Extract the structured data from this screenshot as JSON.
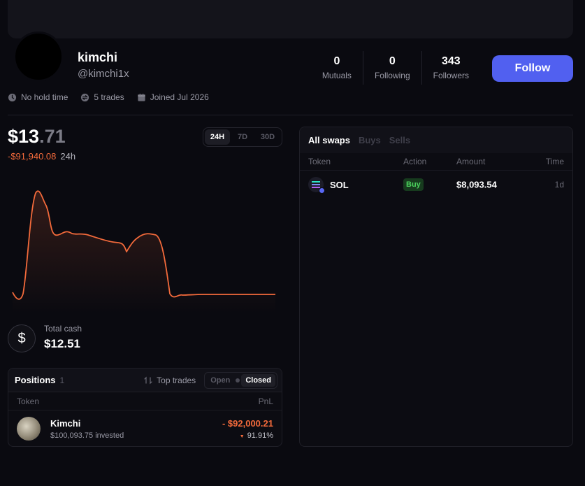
{
  "profile": {
    "name": "kimchi",
    "handle": "@kimchi1x",
    "follow_label": "Follow",
    "stats": [
      {
        "value": "0",
        "label": "Mutuals"
      },
      {
        "value": "0",
        "label": "Following"
      },
      {
        "value": "343",
        "label": "Followers"
      }
    ],
    "meta": {
      "hold_time": "No hold time",
      "trades": "5 trades",
      "joined": "Joined Jul 2026"
    }
  },
  "portfolio": {
    "price_int": "$13",
    "price_dec": ".71",
    "change": "-$91,940.08",
    "change_period": "24h",
    "ranges": [
      "24H",
      "7D",
      "30D"
    ],
    "active_range": "24H",
    "line_color": "#f36a3b",
    "cash_label": "Total cash",
    "cash_icon": "dollar-icon",
    "cash_value": "$12.51"
  },
  "positions": {
    "title": "Positions",
    "count": "1",
    "top_trades_label": "Top trades",
    "toggle": {
      "open": "Open",
      "closed": "Closed",
      "active": "Closed"
    },
    "columns": {
      "token": "Token",
      "pnl": "PnL"
    },
    "rows": [
      {
        "name": "Kimchi",
        "invested": "$100,093.75 invested",
        "pnl": "- $92,000.21",
        "pct": "91.91%"
      }
    ]
  },
  "swaps": {
    "tabs": [
      "All swaps",
      "Buys",
      "Sells"
    ],
    "active_tab": "All swaps",
    "columns": {
      "token": "Token",
      "action": "Action",
      "amount": "Amount",
      "time": "Time"
    },
    "rows": [
      {
        "token": "SOL",
        "action": "Buy",
        "amount": "$8,093.54",
        "time": "1d"
      }
    ]
  }
}
